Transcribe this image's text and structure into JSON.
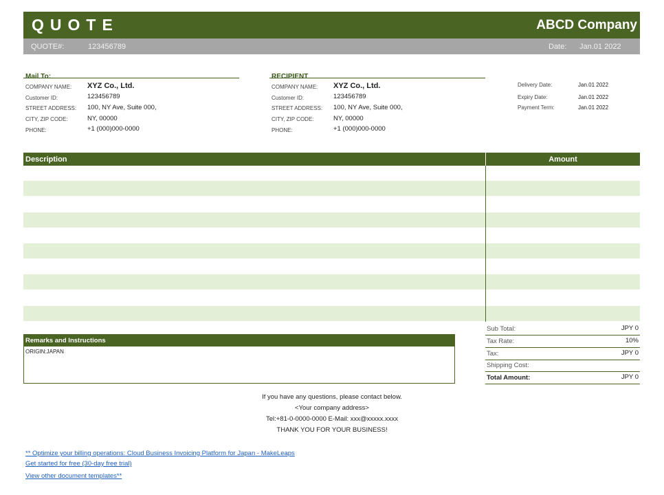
{
  "header": {
    "title": "QUOTE",
    "company": "ABCD Company"
  },
  "subheader": {
    "quote_label": "QUOTE#:",
    "quote_number": "123456789",
    "date_label": "Date:",
    "date_value": "Jan.01 2022"
  },
  "mail_to": {
    "title": "Mail To:",
    "company_label": "COMPANY NAME:",
    "company_value": "XYZ Co., Ltd.",
    "customer_label": "Customer ID:",
    "customer_value": "123456789",
    "street_label": "STREET ADDRESS:",
    "street_value": "100, NY Ave, Suite 000,",
    "city_label": "CITY, ZIP CODE:",
    "city_value": "NY, 00000",
    "phone_label": "PHONE:",
    "phone_value": "+1 (000)000-0000"
  },
  "recipient": {
    "title": "RECIPIENT",
    "company_label": "COMPANY NAME:",
    "company_value": "XYZ Co., Ltd.",
    "customer_label": "Customer ID:",
    "customer_value": "123456789",
    "street_label": "STREET ADDRESS:",
    "street_value": "100, NY Ave, Suite 000,",
    "city_label": "CITY, ZIP CODE:",
    "city_value": "NY, 00000",
    "phone_label": "PHONE:",
    "phone_value": "+1 (000)000-0000"
  },
  "dates": {
    "delivery_label": "Delivery Date:",
    "delivery_value": "Jan.01 2022",
    "expiry_label": "Expiry Date:",
    "expiry_value": "Jan.01 2022",
    "payment_label": "Payment Term:",
    "payment_value": "Jan.01 2022"
  },
  "items": {
    "description_header": "Description",
    "amount_header": "Amount"
  },
  "summary": {
    "subtotal_label": "Sub Total:",
    "subtotal_value": "JPY 0",
    "taxrate_label": "Tax Rate:",
    "taxrate_value": "10%",
    "tax_label": "Tax:",
    "tax_value": "JPY 0",
    "shipping_label": "Shipping Cost:",
    "shipping_value": "",
    "total_label": "Total Amount:",
    "total_value": "JPY 0"
  },
  "remarks": {
    "title": "Remarks and Instructions",
    "text": "ORIGIN:JAPAN"
  },
  "footer": {
    "line1": "If you have any questions, please contact below.",
    "line2": "<Your company address>",
    "line3": "Tel:+81-0-0000-0000  E-Mail: xxx@xxxxx.xxxx",
    "line4": "THANK YOU FOR YOUR BUSINESS!"
  },
  "links": {
    "link1": "** Optimize your billing operations: Cloud Business Invoicing Platform for Japan - MakeLeaps",
    "link2": "Get started for free (30-day free trial)",
    "link3": "View other document templates**"
  },
  "colors": {
    "primary_green": "#4a6424",
    "band_green": "#e4efd7",
    "bar_gray": "#a6a6a6"
  }
}
